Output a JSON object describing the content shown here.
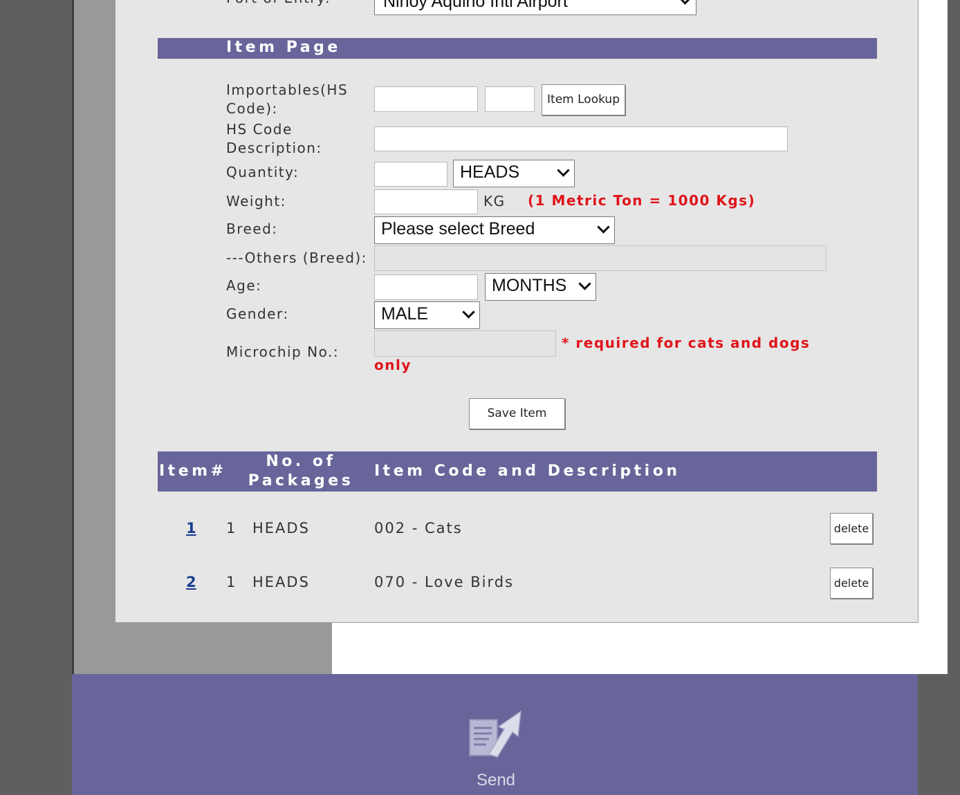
{
  "top": {
    "port_label": "Port of Entry:",
    "port_value": "Ninoy Aquino Intl Airport"
  },
  "section_title": "Item Page",
  "form": {
    "importables_label": "Importables(HS Code):",
    "importables_value1": "",
    "importables_value2": "",
    "item_lookup_button": "Item Lookup",
    "hs_desc_label": "HS Code Description:",
    "hs_desc_value": "",
    "quantity_label": "Quantity:",
    "quantity_value": "",
    "quantity_unit": "HEADS",
    "weight_label": "Weight:",
    "weight_value": "",
    "weight_unit": "KG",
    "weight_note": "(1 Metric Ton = 1000 Kgs)",
    "breed_label": "Breed:",
    "breed_value": "Please select Breed",
    "others_breed_label": "---Others (Breed):",
    "others_breed_value": "",
    "age_label": "Age:",
    "age_value": "",
    "age_unit": "MONTHS",
    "gender_label": "Gender:",
    "gender_value": "MALE",
    "microchip_label": "Microchip No.:",
    "microchip_value": "",
    "microchip_note": "* required for cats and dogs",
    "microchip_note_cont": "only",
    "save_button": "Save Item"
  },
  "table": {
    "headers": {
      "item_no": "Item#",
      "packages_1": "No. of",
      "packages_2": "Packages",
      "description": "Item Code and Description"
    },
    "rows": [
      {
        "item": "1",
        "qty": "1",
        "unit": "HEADS",
        "desc": "002 - Cats",
        "action": "delete"
      },
      {
        "item": "2",
        "qty": "1",
        "unit": "HEADS",
        "desc": "070 - Love Birds",
        "action": "delete"
      }
    ]
  },
  "footer": {
    "send_label": "Send",
    "send_icon": "send-document-icon"
  },
  "colors": {
    "accent": "#68659a",
    "required_text": "#e0141a",
    "link": "#1a3d8f"
  }
}
